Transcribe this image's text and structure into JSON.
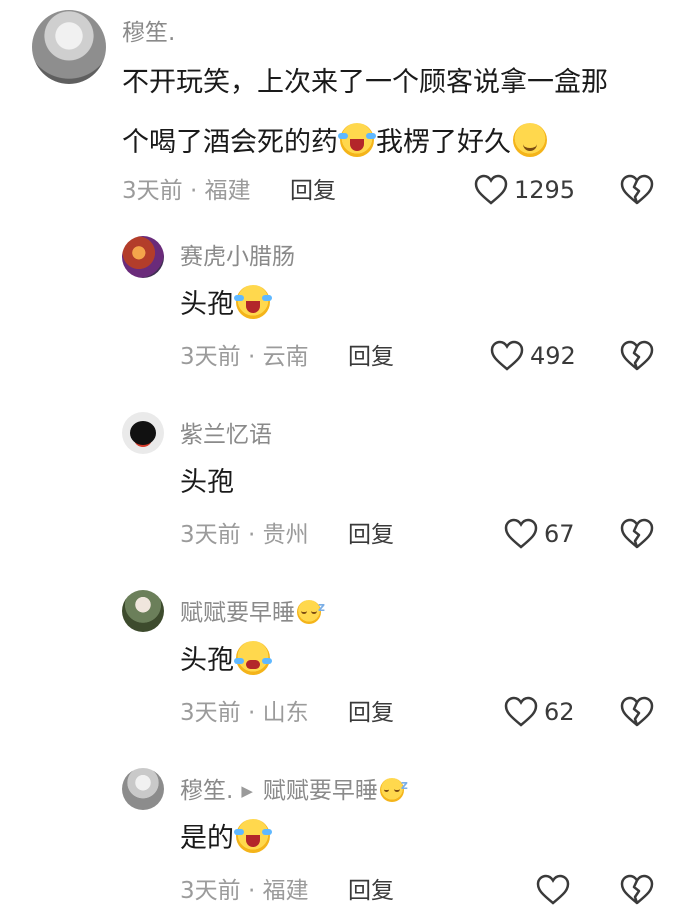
{
  "comments": [
    {
      "user": "穆笙.",
      "text_line1": "不开玩笑，上次来了一个顾客说拿一盒那",
      "text_line2_a": "个喝了酒会死的药",
      "text_line2_b": "我楞了好久",
      "meta": "3天前 · 福建",
      "reply": "回复",
      "likes": "1295"
    }
  ],
  "replies": [
    {
      "user": "赛虎小腊肠",
      "text": "头孢",
      "meta": "3天前 · 云南",
      "reply": "回复",
      "likes": "492"
    },
    {
      "user": "紫兰忆语",
      "text": "头孢",
      "meta": "3天前 · 贵州",
      "reply": "回复",
      "likes": "67"
    },
    {
      "user": "赋赋要早睡",
      "text": "头孢",
      "meta": "3天前 · 山东",
      "reply": "回复",
      "likes": "62"
    },
    {
      "user": "穆笙.",
      "reply_to": "赋赋要早睡",
      "text": "是的",
      "meta": "3天前 · 福建",
      "reply": "回复",
      "likes": ""
    }
  ],
  "icons": {
    "like": "heart-outline-icon",
    "dislike": "broken-heart-icon",
    "reply_arrow": "right-triangle-icon"
  },
  "colors": {
    "name": "#8a8a8a",
    "meta": "#9b9b9b",
    "text": "#1a1a1a"
  }
}
